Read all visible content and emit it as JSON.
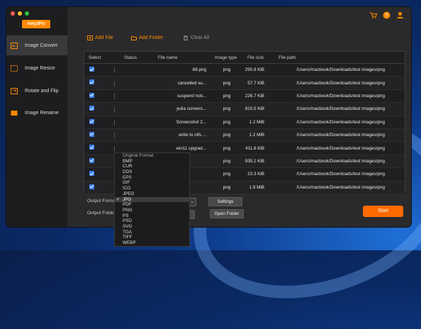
{
  "app": {
    "logo_text": "Amy2Pic"
  },
  "sidebar": {
    "items": [
      {
        "label": "Image Convert"
      },
      {
        "label": "Image Resize"
      },
      {
        "label": "Rotate and Flip"
      },
      {
        "label": "Image Rename"
      }
    ]
  },
  "toolbar": {
    "add_file": "Add File",
    "add_folder": "Add Folder",
    "clear_all": "Clear All"
  },
  "table": {
    "headers": [
      "Select",
      "Status",
      "File name",
      "Image type",
      "File size",
      "File path"
    ],
    "rows": [
      {
        "name": "68.png",
        "type": "png",
        "size": "290.8 KiB",
        "path": "/Users/macbook/Downloads/test images/png"
      },
      {
        "name": "cancelled su...",
        "type": "png",
        "size": "57.7 KiB",
        "path": "/Users/macbook/Downloads/test images/png"
      },
      {
        "name": "suspend noti...",
        "type": "png",
        "size": "226.7 KiB",
        "path": "/Users/macbook/Downloads/test images/png"
      },
      {
        "name": "yulia convers...",
        "type": "png",
        "size": "810.5 KiB",
        "path": "/Users/macbook/Downloads/test images/png"
      },
      {
        "name": "Screenshot 2...",
        "type": "png",
        "size": "1.2 MiB",
        "path": "/Users/macbook/Downloads/test images/png"
      },
      {
        "name": "write to nifs ...",
        "type": "png",
        "size": "1.2 MiB",
        "path": "/Users/macbook/Downloads/test images/png"
      },
      {
        "name": "win11 upgrad...",
        "type": "png",
        "size": "411.8 KiB",
        "path": "/Users/macbook/Downloads/test images/png"
      },
      {
        "name": "",
        "type": "png",
        "size": "935.1 KiB",
        "path": "/Users/macbook/Downloads/test images/png"
      },
      {
        "name": "",
        "type": "png",
        "size": "23.3 KiB",
        "path": "/Users/macbook/Downloads/test images/png"
      },
      {
        "name": "",
        "type": "png",
        "size": "1.9 MiB",
        "path": "/Users/macbook/Downloads/test images/png"
      }
    ]
  },
  "output": {
    "format_label": "Output Format:",
    "folder_label": "Output Folder:",
    "settings": "Settings",
    "open_folder": "Open Folder",
    "start": "Start"
  },
  "dropdown": {
    "header": "Original Format",
    "options": [
      "BMP",
      "CUR",
      "DDS",
      "EPS",
      "GIF",
      "ICO",
      "JPEG",
      "JPG",
      "PDF",
      "PNG",
      "PS",
      "PSD",
      "SVG",
      "TGA",
      "TIFF",
      "WEBP"
    ],
    "selected": "JPG"
  },
  "colors": {
    "accent": "#ff6a00",
    "checkbox": "#3b82f6"
  }
}
